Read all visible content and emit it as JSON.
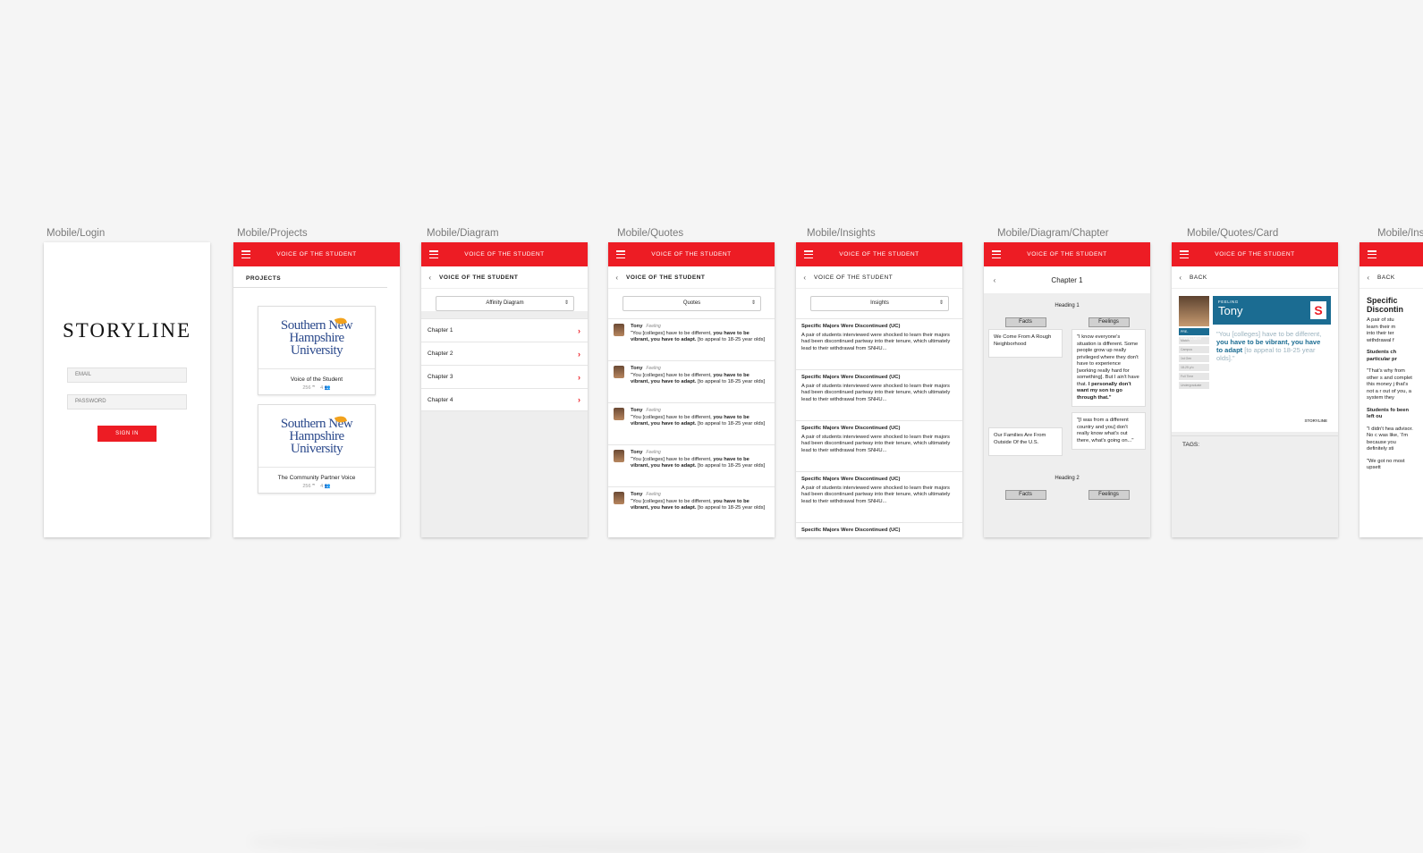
{
  "frames": [
    {
      "label": "Mobile/Login"
    },
    {
      "label": "Mobile/Projects"
    },
    {
      "label": "Mobile/Diagram"
    },
    {
      "label": "Mobile/Quotes"
    },
    {
      "label": "Mobile/Insights"
    },
    {
      "label": "Mobile/Diagram/Chapter"
    },
    {
      "label": "Mobile/Quotes/Card"
    },
    {
      "label": "Mobile/Ins"
    }
  ],
  "app_title": "VOICE OF THE STUDENT",
  "login": {
    "logo": "STORYLINE",
    "email_placeholder": "EMAIL",
    "password_placeholder": "PASSWORD",
    "sign_in": "SIGN IN"
  },
  "projects": {
    "heading": "PROJECTS",
    "university": "Southern New Hampshire University",
    "items": [
      {
        "name": "Voice of the Student",
        "quotes": "256",
        "people": "4"
      },
      {
        "name": "The Community Partner Voice",
        "quotes": "256",
        "people": "4"
      }
    ]
  },
  "diagram": {
    "subtitle": "VOICE OF THE STUDENT",
    "select": "Affinity Diagram",
    "chapters": [
      "Chapter 1",
      "Chapter 2",
      "Chapter 3",
      "Chapter 4"
    ]
  },
  "quotes": {
    "subtitle": "VOICE OF THE STUDENT",
    "select": "Quotes",
    "items": [
      {
        "name": "Tony",
        "tag": "Feeling",
        "pre": "\"You [colleges] have to be different, ",
        "bold": "you have to be vibrant, you have to adapt.",
        "post": " [to appeal to 18-25 year olds]"
      },
      {
        "name": "Tony",
        "tag": "Feeling",
        "pre": "\"You [colleges] have to be different, ",
        "bold": "you have to be vibrant, you have to adapt.",
        "post": " [to appeal to 18-25 year olds]"
      },
      {
        "name": "Tony",
        "tag": "Feeling",
        "pre": "\"You [colleges] have to be different, ",
        "bold": "you have to be vibrant, you have to adapt.",
        "post": " [to appeal to 18-25 year olds]"
      },
      {
        "name": "Tony",
        "tag": "Feeling",
        "pre": "\"You [colleges] have to be different, ",
        "bold": "you have to be vibrant, you have to adapt.",
        "post": " [to appeal to 18-25 year olds]"
      },
      {
        "name": "Tony",
        "tag": "Feeling",
        "pre": "\"You [colleges] have to be different, ",
        "bold": "you have to be vibrant, you have to adapt.",
        "post": " [to appeal to 18-25 year olds]"
      }
    ]
  },
  "insights": {
    "subtitle": "VOICE OF THE STUDENT",
    "select": "Insights",
    "items": [
      {
        "title": "Specific Majors Were Discontinued (UC)",
        "body": "A pair of students interviewed were shocked to learn their majors had been discontinued partway into their tenure, which ultimately lead to their withdrawal from SNHU..."
      },
      {
        "title": "Specific Majors Were Discontinued (UC)",
        "body": "A pair of students interviewed were shocked to learn their majors had been discontinued partway into their tenure, which ultimately lead to their withdrawal from SNHU..."
      },
      {
        "title": "Specific Majors Were Discontinued (UC)",
        "body": "A pair of students interviewed were shocked to learn their majors had been discontinued partway into their tenure, which ultimately lead to their withdrawal from SNHU..."
      },
      {
        "title": "Specific Majors Were Discontinued (UC)",
        "body": "A pair of students interviewed were shocked to learn their majors had been discontinued partway into their tenure, which ultimately lead to their withdrawal from SNHU..."
      },
      {
        "title": "Specific Majors Were Discontinued (UC)",
        "body": ""
      }
    ]
  },
  "chapter": {
    "title": "Chapter 1",
    "heading1": "Heading 1",
    "heading2": "Heading 2",
    "facts_label": "Facts",
    "feelings_label": "Feelings",
    "fact1": "We Come From A Rough Neighborhood",
    "fact2": "Our Families Are From Outside Of the U.S.",
    "feeling1_pre": "\"I know everyone's situation is different. Some people grow up really privileged where they don't have to experience [working really hard for something]. But I ain't have that. ",
    "feeling1_bold": "I personally don't want my son to go through that.\"",
    "feeling2": "\"[I was from a different country and you] don't really know what's out there, what's going on...\""
  },
  "card": {
    "back": "BACK",
    "kind": "FEELING",
    "name": "Tony",
    "quote_pre": "\"You [colleges] have to be different, ",
    "quote_bold": "you have to be vibrant, you have to adapt",
    "quote_post": " [to appeal to 18-25 year olds].\"",
    "side_items": [
      "PRE-ENROLLMENT",
      "Match",
      "Campus",
      "1st Gen",
      "18-25 y/o",
      "Full Time",
      "Undergraduate"
    ],
    "brand": "STORYLINE",
    "tags_label": "TAGS:"
  },
  "insight_detail": {
    "back": "BACK",
    "heading": "Specific Discontin",
    "lines": [
      "A pair of stu",
      "learn their m",
      "into their ter",
      "withdrawal f"
    ],
    "sub1": "Students ch particular pr",
    "para1": "\"That's why from other s and complet this money j that's not a r out of you, a system they",
    "sub2": "Students fo been left ou",
    "para2": "\"I didn't hea advisor. No c was like, 'I'm because you definitely sti",
    "para3": "\"We got no most upsett"
  },
  "colors": {
    "accent": "#ed1c24",
    "card_blue": "#1b6c92",
    "canvas": "#f5f5f5"
  }
}
